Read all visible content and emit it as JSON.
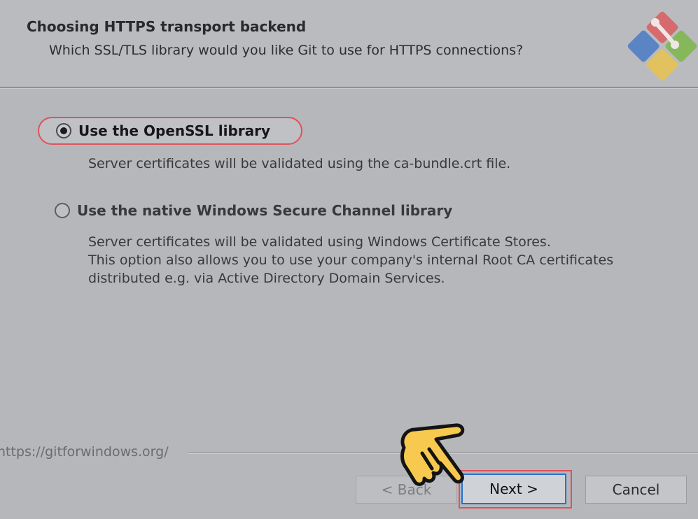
{
  "header": {
    "title": "Choosing HTTPS transport backend",
    "subtitle": "Which SSL/TLS library would you like Git to use for HTTPS connections?",
    "logo_icon": "git-logo-icon"
  },
  "options": [
    {
      "label": "Use the OpenSSL library",
      "selected": true,
      "description": [
        "Server certificates will be validated using the ca-bundle.crt file."
      ]
    },
    {
      "label": "Use the native Windows Secure Channel library",
      "selected": false,
      "description": [
        "Server certificates will be validated using Windows Certificate Stores.",
        "This option also allows you to use your company's internal Root CA certificates",
        "distributed e.g. via Active Directory Domain Services."
      ]
    }
  ],
  "footer": {
    "link": "https://gitforwindows.org/"
  },
  "buttons": {
    "back": "< Back",
    "next": "Next >",
    "cancel": "Cancel"
  },
  "colors": {
    "highlight": "#e0525a",
    "focus_border": "#2a6fd1",
    "pointer_hand": "#f7c94f"
  },
  "pointer_icon": "pointing-hand-icon"
}
